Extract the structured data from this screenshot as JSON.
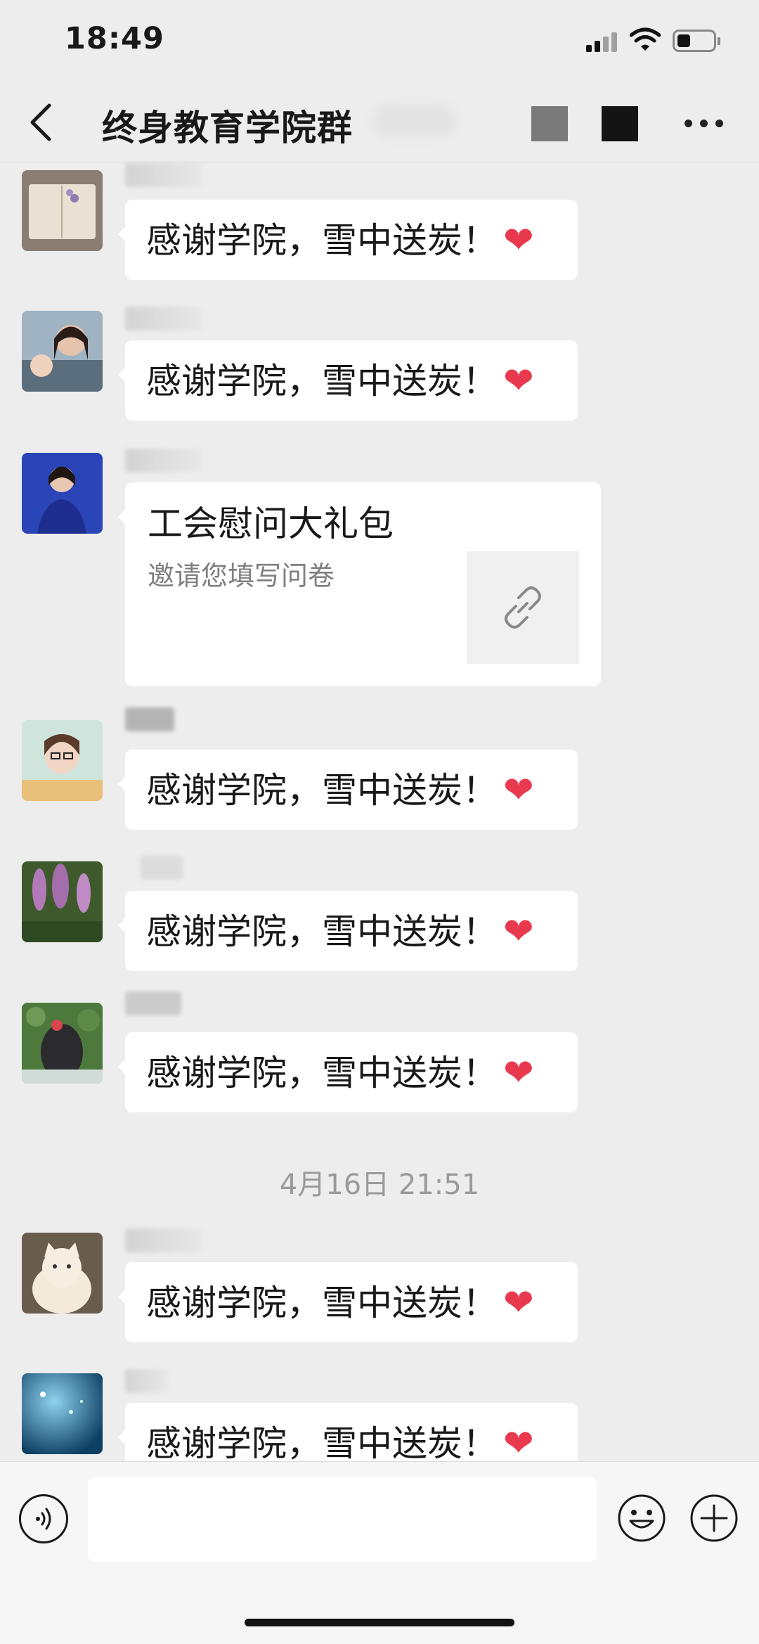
{
  "status_bar": {
    "time": "18:49"
  },
  "header": {
    "title": "终身教育学院群"
  },
  "messages": [
    {
      "text": "感谢学院，雪中送炭！",
      "emoji": "❤"
    },
    {
      "text": "感谢学院，雪中送炭！",
      "emoji": "❤"
    },
    {
      "card_title": "工会慰问大礼包",
      "card_desc": "邀请您填写问卷",
      "card_icon": "link-icon"
    },
    {
      "text": "感谢学院，雪中送炭！",
      "emoji": "❤"
    },
    {
      "text": "感谢学院，雪中送炭！",
      "emoji": "❤"
    },
    {
      "text": "感谢学院，雪中送炭！",
      "emoji": "❤"
    },
    {
      "text": "感谢学院，雪中送炭！",
      "emoji": "❤"
    },
    {
      "text": "感谢学院，雪中送炭！",
      "emoji": "❤"
    }
  ],
  "timestamp": "4月16日 21:51",
  "input_bar": {
    "placeholder": "",
    "icons": [
      "voice-icon",
      "emoji-icon",
      "plus-icon"
    ]
  },
  "colors": {
    "background": "#ededed",
    "bubble": "#ffffff",
    "heart": "#e8394f"
  }
}
